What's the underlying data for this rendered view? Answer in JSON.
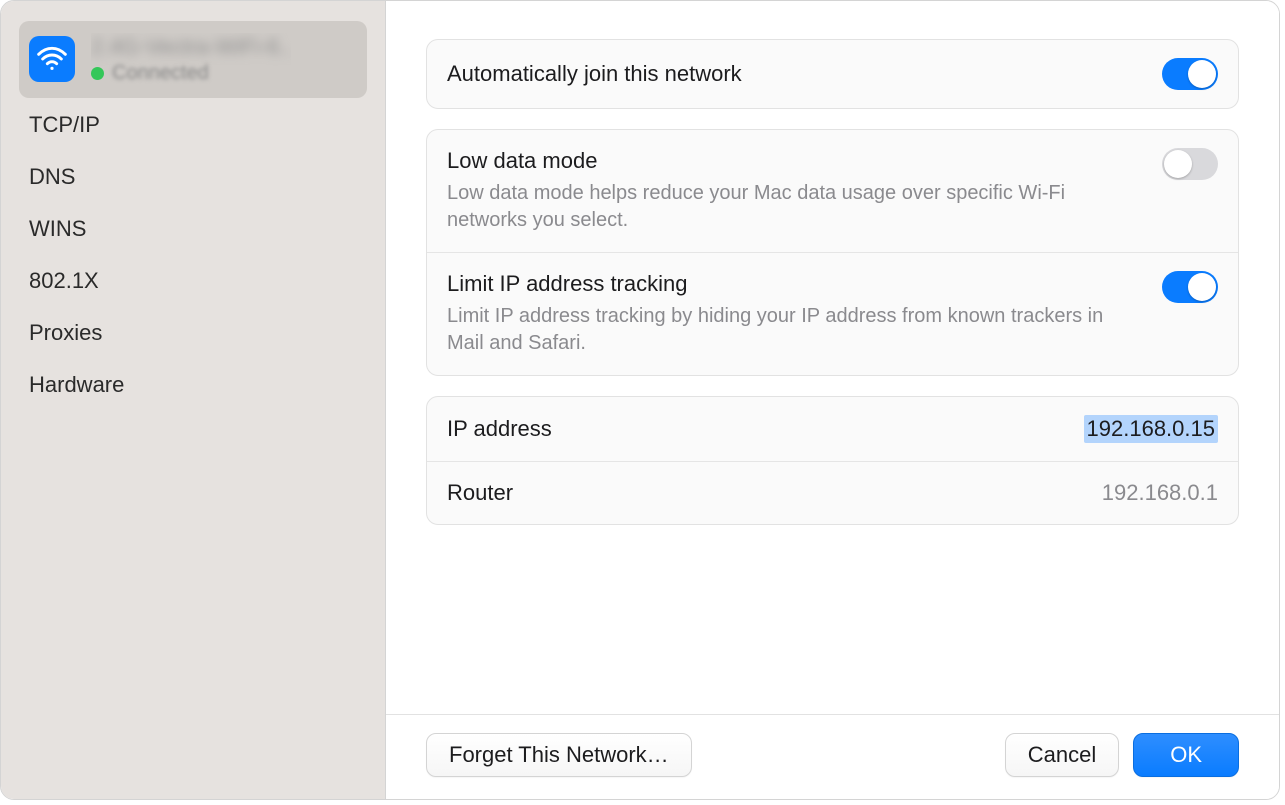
{
  "sidebar": {
    "network": {
      "name": "2.4G-Vectra-WiFi-6..",
      "status": "Connected"
    },
    "items": [
      {
        "label": "TCP/IP"
      },
      {
        "label": "DNS"
      },
      {
        "label": "WINS"
      },
      {
        "label": "802.1X"
      },
      {
        "label": "Proxies"
      },
      {
        "label": "Hardware"
      }
    ]
  },
  "settings": {
    "autoJoin": {
      "title": "Automatically join this network",
      "on": true
    },
    "lowData": {
      "title": "Low data mode",
      "desc": "Low data mode helps reduce your Mac data usage over specific Wi-Fi networks you select.",
      "on": false
    },
    "limitIP": {
      "title": "Limit IP address tracking",
      "desc": "Limit IP address tracking by hiding your IP address from known trackers in Mail and Safari.",
      "on": true
    },
    "ip": {
      "label": "IP address",
      "value": "192.168.0.15"
    },
    "router": {
      "label": "Router",
      "value": "192.168.0.1"
    }
  },
  "footer": {
    "forget": "Forget This Network…",
    "cancel": "Cancel",
    "ok": "OK"
  }
}
